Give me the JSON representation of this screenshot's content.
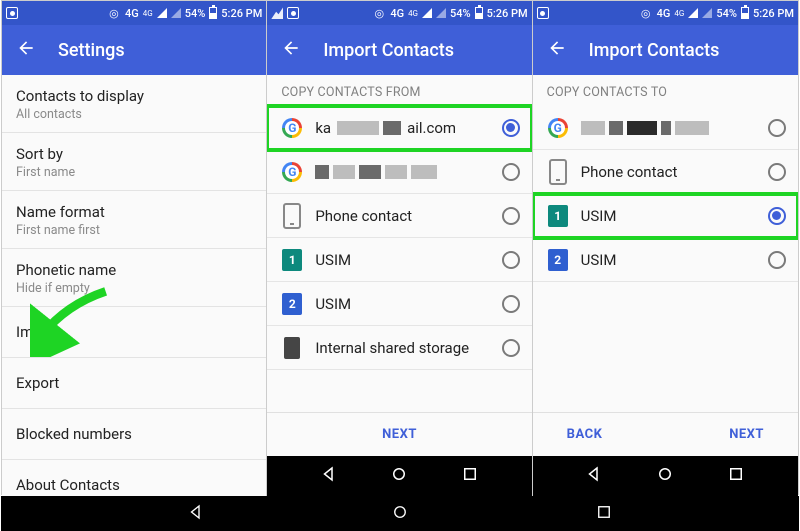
{
  "status": {
    "network": "4G",
    "battery": "54%",
    "time": "5:26 PM"
  },
  "screen1": {
    "title": "Settings",
    "rows": [
      {
        "primary": "Contacts to display",
        "secondary": "All contacts"
      },
      {
        "primary": "Sort by",
        "secondary": "First name"
      },
      {
        "primary": "Name format",
        "secondary": "First name first"
      },
      {
        "primary": "Phonetic name",
        "secondary": "Hide if empty"
      },
      {
        "primary": "Import"
      },
      {
        "primary": "Export"
      },
      {
        "primary": "Blocked numbers"
      },
      {
        "primary": "About Contacts"
      }
    ]
  },
  "screen2": {
    "title": "Import Contacts",
    "section": "COPY CONTACTS FROM",
    "options": {
      "acct1_prefix": "ka",
      "acct1_suffix": "ail.com",
      "phone": "Phone contact",
      "usim1": "USIM",
      "usim2": "USIM",
      "storage": "Internal shared storage"
    },
    "next": "NEXT"
  },
  "screen3": {
    "title": "Import Contacts",
    "section": "COPY CONTACTS TO",
    "options": {
      "phone": "Phone contact",
      "usim1": "USIM",
      "usim2": "USIM"
    },
    "back": "BACK",
    "next": "NEXT"
  }
}
